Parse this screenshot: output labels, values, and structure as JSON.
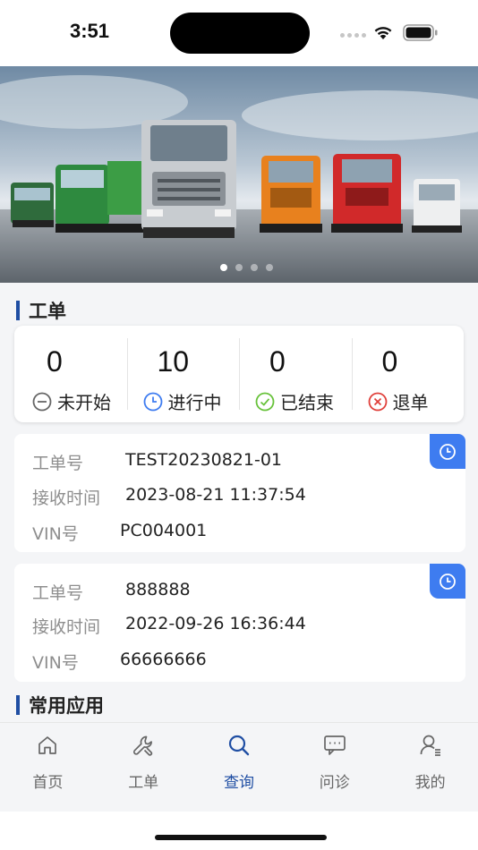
{
  "status_bar": {
    "time": "3:51"
  },
  "banner": {
    "slides": 4,
    "active_slide": 0
  },
  "work_orders_section": {
    "title": "工单"
  },
  "stats": [
    {
      "count": "0",
      "label": "未开始",
      "icon": "minus-circle-icon",
      "color": "#666666"
    },
    {
      "count": "10",
      "label": "进行中",
      "icon": "clock-circle-icon",
      "color": "#3e7cf0"
    },
    {
      "count": "0",
      "label": "已结束",
      "icon": "check-circle-icon",
      "color": "#67c23a"
    },
    {
      "count": "0",
      "label": "退单",
      "icon": "x-circle-icon",
      "color": "#e0403b"
    }
  ],
  "orders": [
    {
      "number_label": "工单号",
      "number": "TEST20230821-01",
      "time_label": "接收时间",
      "time": "2023-08-21 11:37:54",
      "vin_label": "VIN号",
      "vin": "PC004001",
      "status_icon": "clock-icon"
    },
    {
      "number_label": "工单号",
      "number": "888888",
      "time_label": "接收时间",
      "time": "2022-09-26 16:36:44",
      "vin_label": "VIN号",
      "vin": "66666666",
      "status_icon": "clock-icon"
    }
  ],
  "apps_section": {
    "title": "常用应用"
  },
  "tab_bar": {
    "active_index": 2,
    "accent_color": "#1f4ea3",
    "tabs": [
      {
        "label": "首页",
        "icon": "home-icon"
      },
      {
        "label": "工单",
        "icon": "wrench-icon"
      },
      {
        "label": "查询",
        "icon": "search-icon"
      },
      {
        "label": "问诊",
        "icon": "chat-icon"
      },
      {
        "label": "我的",
        "icon": "user-icon"
      }
    ]
  }
}
